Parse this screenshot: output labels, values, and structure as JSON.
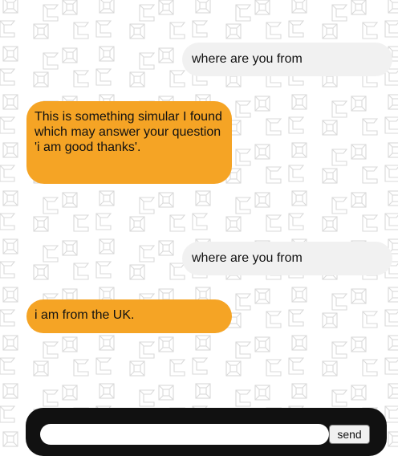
{
  "messages": [
    {
      "sender": "user",
      "text": "where are you from"
    },
    {
      "sender": "bot",
      "text": "This is something simular I found which may answer your question 'i am good thanks'."
    },
    {
      "sender": "user",
      "text": "where are you from"
    },
    {
      "sender": "bot",
      "text": "i am from the UK."
    }
  ],
  "composer": {
    "input_value": "",
    "send_label": "send"
  },
  "colors": {
    "user_bubble": "#f1f1f1",
    "bot_bubble": "#f5a425",
    "composer_bar": "#111111",
    "background_pattern": "#d9d9d9"
  }
}
